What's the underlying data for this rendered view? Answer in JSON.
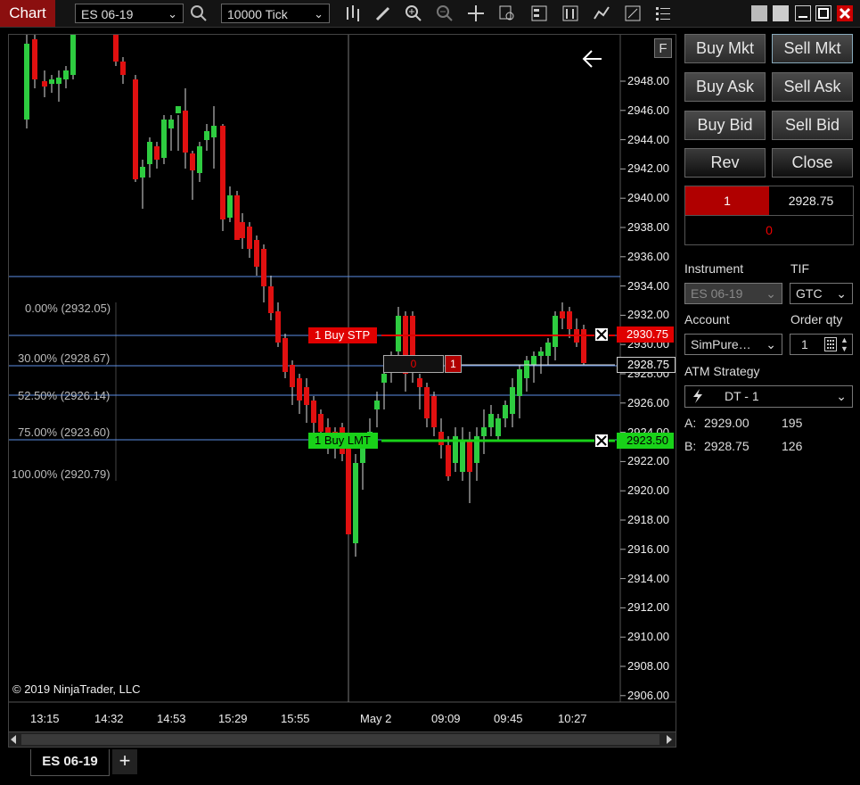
{
  "toolbar": {
    "title": "Chart",
    "instrument": "ES 06-19",
    "interval": "10000 Tick",
    "icons": [
      "search-icon",
      "bar-type-icon",
      "drawing-tool-icon",
      "zoom-in-icon",
      "zoom-out-icon",
      "crosshair-icon",
      "data-box-icon",
      "properties-icon",
      "chart-trader-icon",
      "strategies-icon",
      "indicators-icon",
      "templates-icon",
      "more-icon"
    ]
  },
  "chart": {
    "copyright": "© 2019 NinjaTrader, LLC",
    "f_button": "F",
    "price_labels": [
      "2948.00",
      "2946.00",
      "2944.00",
      "2942.00",
      "2940.00",
      "2938.00",
      "2936.00",
      "2934.00",
      "2932.00",
      "2930.00",
      "2928.00",
      "2926.00",
      "2924.00",
      "2922.00",
      "2920.00",
      "2918.00",
      "2916.00",
      "2914.00",
      "2912.00",
      "2910.00",
      "2908.00",
      "2906.00"
    ],
    "time_labels": [
      "13:15",
      "14:32",
      "14:53",
      "15:29",
      "15:55",
      "May 2",
      "09:09",
      "09:45",
      "10:27"
    ],
    "fib_labels": [
      "0.00% (2932.05)",
      "30.00% (2928.67)",
      "52.50% (2926.14)",
      "75.00% (2923.60)",
      "100.00% (2920.79)"
    ],
    "orders": {
      "stop": {
        "qty": "1",
        "label": "Buy STP",
        "price": "2930.75"
      },
      "limit": {
        "qty": "1",
        "label": "Buy LMT",
        "price": "2923.50"
      },
      "position": {
        "pnl": "0",
        "qty": "1",
        "price": "2928.75"
      }
    },
    "colors": {
      "up": "#2ecc40",
      "down": "#e01010",
      "fib": "#5b8ee6",
      "stop": "#e00000",
      "limit": "#19d219"
    }
  },
  "trader": {
    "buttons": {
      "buy_mkt": "Buy Mkt",
      "sell_mkt": "Sell Mkt",
      "buy_ask": "Buy Ask",
      "sell_ask": "Sell Ask",
      "buy_bid": "Buy Bid",
      "sell_bid": "Sell Bid",
      "rev": "Rev",
      "close": "Close"
    },
    "position": {
      "qty": "1",
      "price": "2928.75",
      "pnl": "0"
    },
    "instrument_label": "Instrument",
    "instrument_value": "ES 06-19",
    "tif_label": "TIF",
    "tif_value": "GTC",
    "account_label": "Account",
    "account_value": "SimPure…",
    "order_qty_label": "Order qty",
    "order_qty_value": "1",
    "atm_label": "ATM Strategy",
    "atm_value": "DT - 1",
    "ask": {
      "label": "A:",
      "price": "2929.00",
      "size": "195"
    },
    "bid": {
      "label": "B:",
      "price": "2928.75",
      "size": "126"
    }
  },
  "tabs": [
    {
      "label": "ES 06-19"
    }
  ],
  "add_tab": "+"
}
